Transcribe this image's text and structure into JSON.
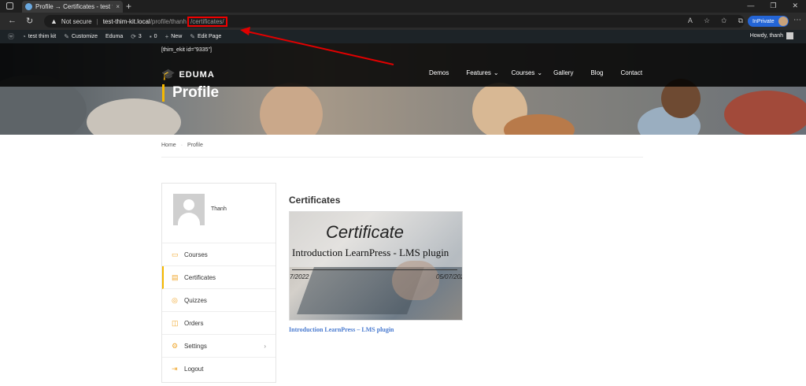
{
  "browser": {
    "tab_title": "Profile → Certificates - test thim",
    "tab_close": "×",
    "new_tab": "+",
    "url_not_secure": "Not secure",
    "url_host": "test-thim-kit.local",
    "url_path": "/profile/thanh",
    "url_highlight": "/certificates/",
    "inprivate": "InPrivate"
  },
  "adminbar": {
    "site": "test thim kit",
    "customize": "Customize",
    "theme": "Eduma",
    "updates": "3",
    "comments": "0",
    "new": "New",
    "edit": "Edit Page",
    "howdy": "Howdy, thanh"
  },
  "header": {
    "shortcode": "[thim_ekit id=\"9335\"]",
    "logo": "EDUMA",
    "nav": [
      {
        "label": "Demos"
      },
      {
        "label": "Features"
      },
      {
        "label": "Courses"
      },
      {
        "label": "Gallery"
      },
      {
        "label": "Blog"
      },
      {
        "label": "Contact"
      }
    ],
    "title": "Profile"
  },
  "breadcrumb": {
    "home": "Home",
    "current": "Profile"
  },
  "profile": {
    "username": "Thanh",
    "menu": [
      {
        "label": "Courses"
      },
      {
        "label": "Certificates"
      },
      {
        "label": "Quizzes"
      },
      {
        "label": "Orders"
      },
      {
        "label": "Settings"
      },
      {
        "label": "Logout"
      }
    ]
  },
  "content": {
    "title": "Certificates",
    "certificate": {
      "heading": "Certificate",
      "course": "Introduction LearnPress - LMS plugin",
      "date_left": "7/2022",
      "date_right": "05/07/202",
      "link": "Introduction LearnPress – LMS plugin"
    }
  },
  "colors": {
    "accent": "#f5b800",
    "link": "#4a7bd0",
    "annotation": "#e00000"
  }
}
